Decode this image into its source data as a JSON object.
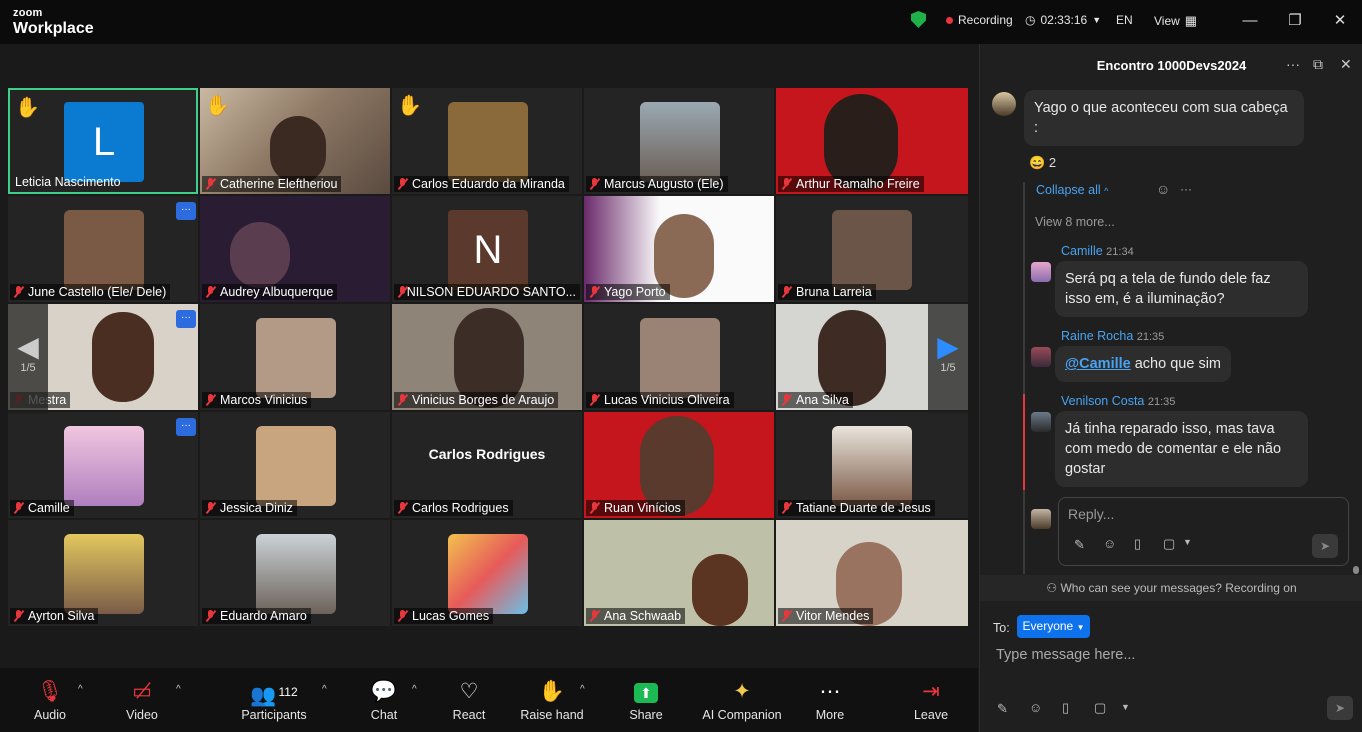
{
  "titlebar": {
    "brand_top": "zoom",
    "brand_main": "Workplace",
    "recording": "Recording",
    "timer": "02:33:16",
    "language": "EN",
    "view": "View"
  },
  "grid": {
    "page_left": "1/5",
    "page_right": "1/5",
    "tiles": [
      {
        "name": "Leticia Nascimento",
        "initial": "L"
      },
      {
        "name": "Catherine Eleftheriou"
      },
      {
        "name": "Carlos Eduardo da Miranda"
      },
      {
        "name": "Marcus Augusto (Ele)"
      },
      {
        "name": "Arthur Ramalho Freire"
      },
      {
        "name": "June Castello (Ele/ Dele)"
      },
      {
        "name": "Audrey Albuquerque"
      },
      {
        "name": "NILSON EDUARDO SANTO...",
        "initial": "N"
      },
      {
        "name": "Yago Porto"
      },
      {
        "name": "Bruna Larreia"
      },
      {
        "name": "Mestra"
      },
      {
        "name": "Marcos Vinicius"
      },
      {
        "name": "Vinicius Borges de Araujo"
      },
      {
        "name": "Lucas Vinicius Oliveira"
      },
      {
        "name": "Ana Silva"
      },
      {
        "name": "Camille"
      },
      {
        "name": "Jessica Diniz"
      },
      {
        "name": "Carlos Rodrigues",
        "big": "Carlos Rodrigues"
      },
      {
        "name": "Ruan Vinícios"
      },
      {
        "name": "Tatiane Duarte de Jesus"
      },
      {
        "name": "Ayrton Silva"
      },
      {
        "name": "Eduardo Amaro"
      },
      {
        "name": "Lucas Gomes"
      },
      {
        "name": "Ana Schwaab"
      },
      {
        "name": "Vitor Mendes"
      }
    ]
  },
  "toolbar": {
    "audio": "Audio",
    "video": "Video",
    "participants": "Participants",
    "participants_count": "112",
    "chat": "Chat",
    "react": "React",
    "raise_hand": "Raise hand",
    "share": "Share",
    "ai_companion": "AI Companion",
    "more": "More",
    "leave": "Leave"
  },
  "chat": {
    "title": "Encontro 1000Devs2024",
    "first_message": "Yago o que aconteceu com sua cabeça :",
    "reaction_count": "2",
    "collapse_all": "Collapse all",
    "view_more": "View 8 more...",
    "replies": [
      {
        "author": "Camille",
        "time": "21:34",
        "text": "Será pq a tela de fundo dele faz isso em, é a iluminação?"
      },
      {
        "author": "Raine Rocha",
        "time": "21:35",
        "mention": "@Camille",
        "text": " acho que sim"
      },
      {
        "author": "Venilson Costa",
        "time": "21:35",
        "text": "Já tinha reparado isso, mas tava com medo de comentar e ele não gostar"
      }
    ],
    "reply_placeholder": "Reply...",
    "visibility": "Who can see your messages? Recording on",
    "to_label": "To:",
    "recipient": "Everyone",
    "message_placeholder": "Type message here..."
  },
  "colors": {
    "accent": "#0e72ed",
    "recording": "#e8373c",
    "security": "#20b24a",
    "active_speaker": "#3ed08a"
  }
}
